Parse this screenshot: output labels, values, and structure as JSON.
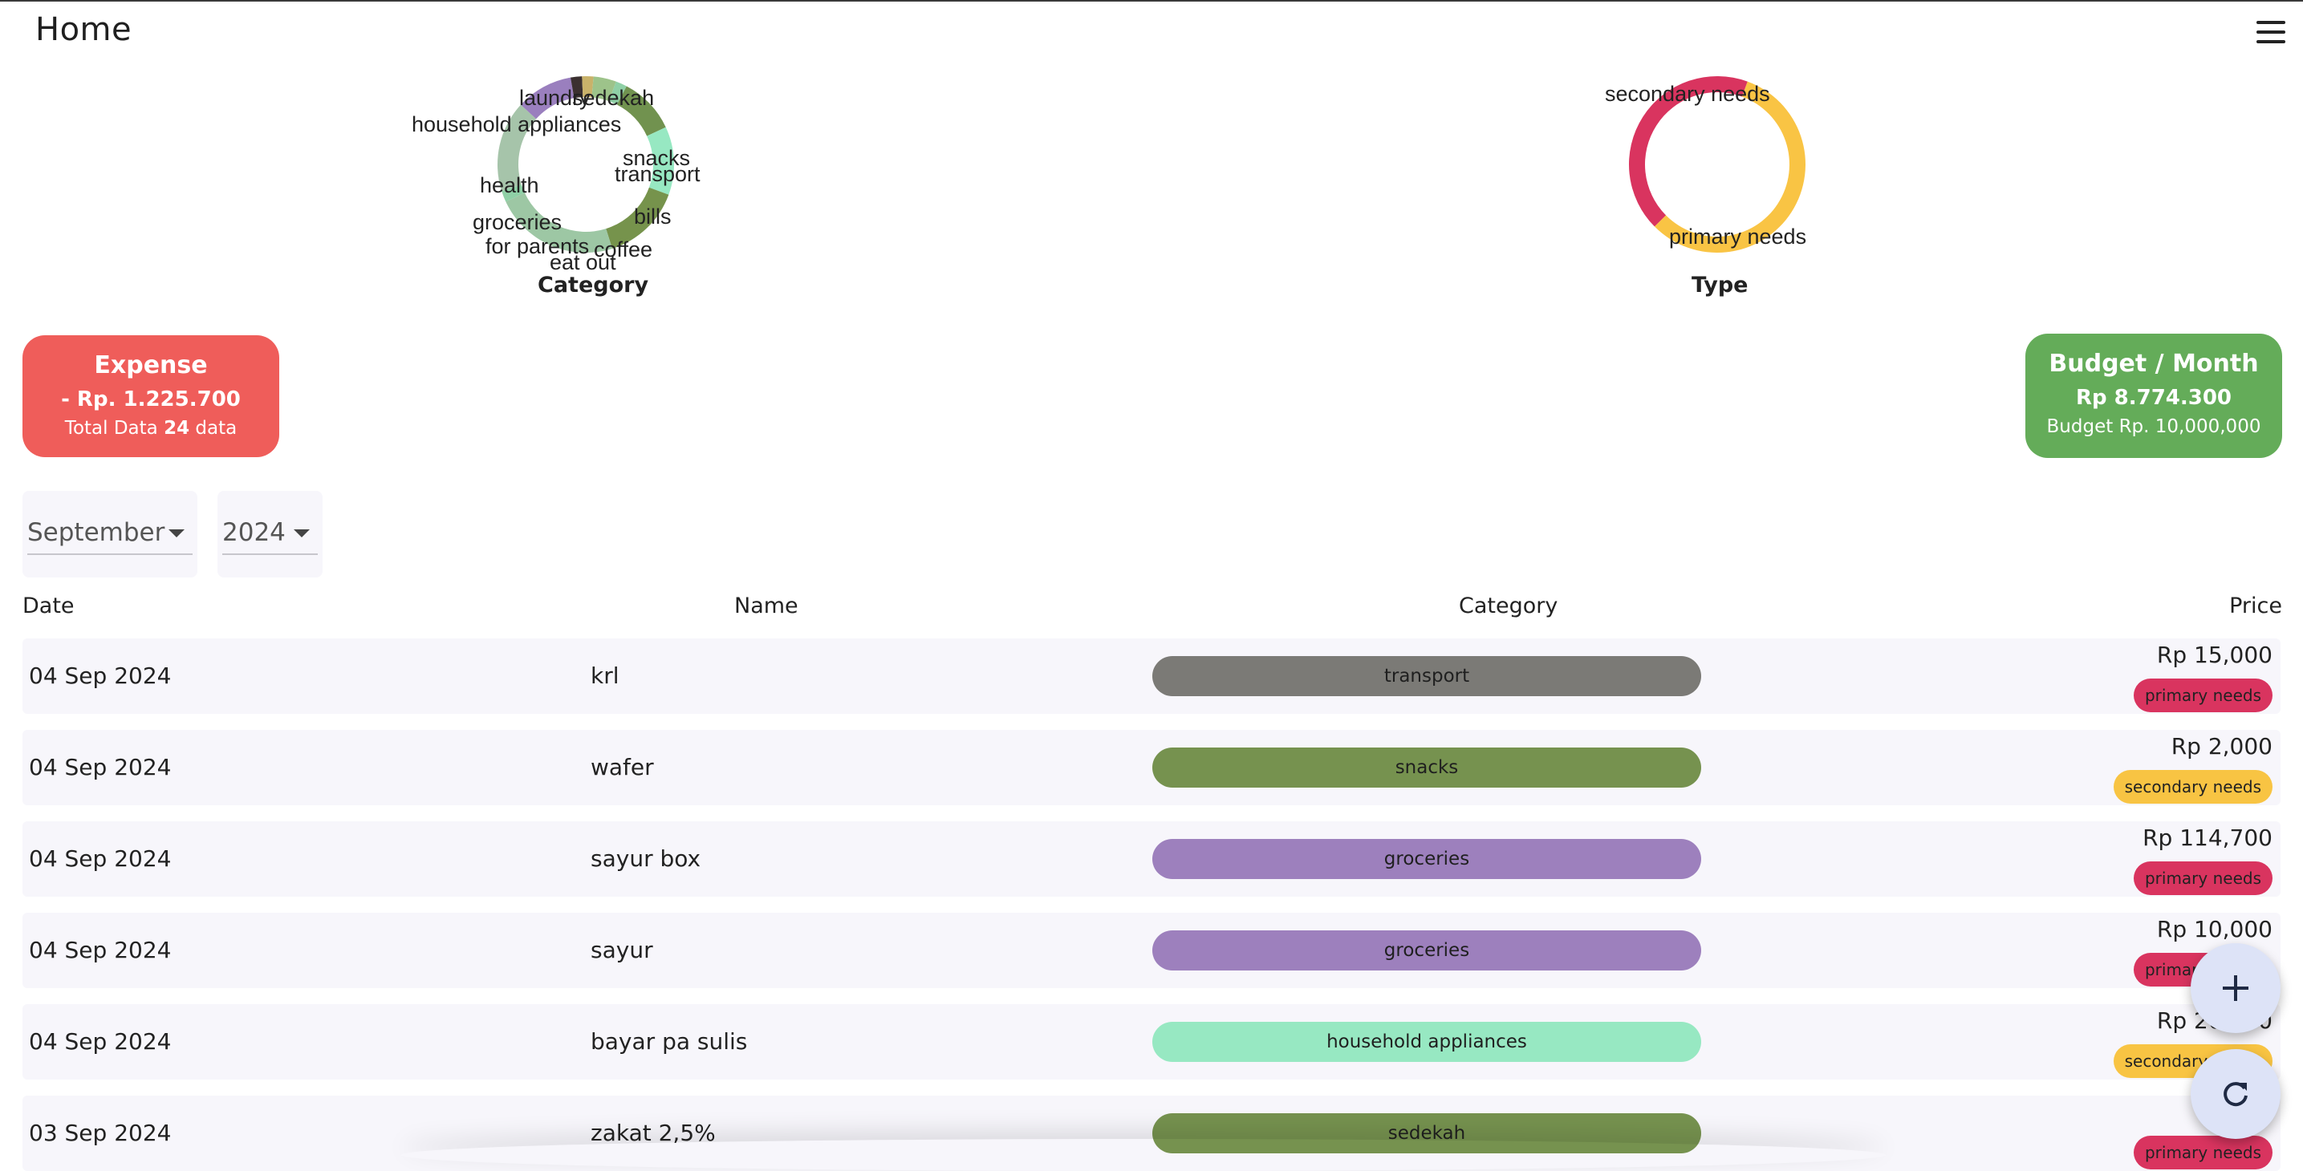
{
  "app": {
    "title": "Home"
  },
  "category_chart": {
    "title": "Category",
    "chart_data": {
      "type": "pie",
      "categories": [
        "laundry",
        "sedekah",
        "household appliances",
        "snacks",
        "transport",
        "health",
        "bills",
        "groceries",
        "coffee",
        "for parents",
        "eat out"
      ],
      "values": [
        1,
        5,
        6,
        7,
        11,
        1,
        8,
        5,
        1,
        1,
        2
      ],
      "colors": [
        "#8fd0a6",
        "#71924f",
        "#97e8c2",
        "#76934c",
        "#9dc7a4",
        "#8fd0a6",
        "#a6c4aa",
        "#9a7fbe",
        "#3b3030",
        "#c9b26a",
        "#9dc38a"
      ]
    }
  },
  "type_chart": {
    "title": "Type",
    "chart_data": {
      "type": "pie",
      "categories": [
        "secondary needs",
        "primary needs"
      ],
      "values": [
        57,
        43
      ],
      "colors": [
        "#f9c444",
        "#d9345f"
      ]
    }
  },
  "expense_card": {
    "title": "Expense",
    "amount": "- Rp. 1.225.700",
    "total_prefix": "Total Data",
    "total_count": "24",
    "total_suffix": "data"
  },
  "budget_card": {
    "title": "Budget / Month",
    "amount": "Rp 8.774.300",
    "budget": "Budget Rp. 10,000,000"
  },
  "filters": {
    "month": "September",
    "year": "2024"
  },
  "table": {
    "headers": {
      "date": "Date",
      "name": "Name",
      "category": "Category",
      "price": "Price"
    },
    "rows": [
      {
        "date": "04 Sep 2024",
        "name": "krl",
        "category": "transport",
        "category_color": "#7b7a76",
        "price": "Rp 15,000",
        "type": "primary needs",
        "type_color": "#d9345f"
      },
      {
        "date": "04 Sep 2024",
        "name": "wafer",
        "category": "snacks",
        "category_color": "#76924f",
        "price": "Rp 2,000",
        "type": "secondary needs",
        "type_color": "#f8c443"
      },
      {
        "date": "04 Sep 2024",
        "name": "sayur box",
        "category": "groceries",
        "category_color": "#9d80bd",
        "price": "Rp 114,700",
        "type": "primary needs",
        "type_color": "#d9345f"
      },
      {
        "date": "04 Sep 2024",
        "name": "sayur",
        "category": "groceries",
        "category_color": "#9d80bd",
        "price": "Rp 10,000",
        "type": "primary needs",
        "type_color": "#d9345f"
      },
      {
        "date": "04 Sep 2024",
        "name": "bayar pa sulis",
        "category": "household appliances",
        "category_color": "#97e8c2",
        "price": "Rp 20,000",
        "type": "secondary needs",
        "type_color": "#f8c443"
      },
      {
        "date": "03 Sep 2024",
        "name": "zakat 2,5%",
        "category": "sedekah",
        "category_color": "#76924f",
        "price": "Rp 3",
        "type": "primary needs",
        "type_color": "#d9345f"
      }
    ]
  },
  "fabs": {
    "add_icon": "plus-icon",
    "refresh_icon": "refresh-icon"
  }
}
